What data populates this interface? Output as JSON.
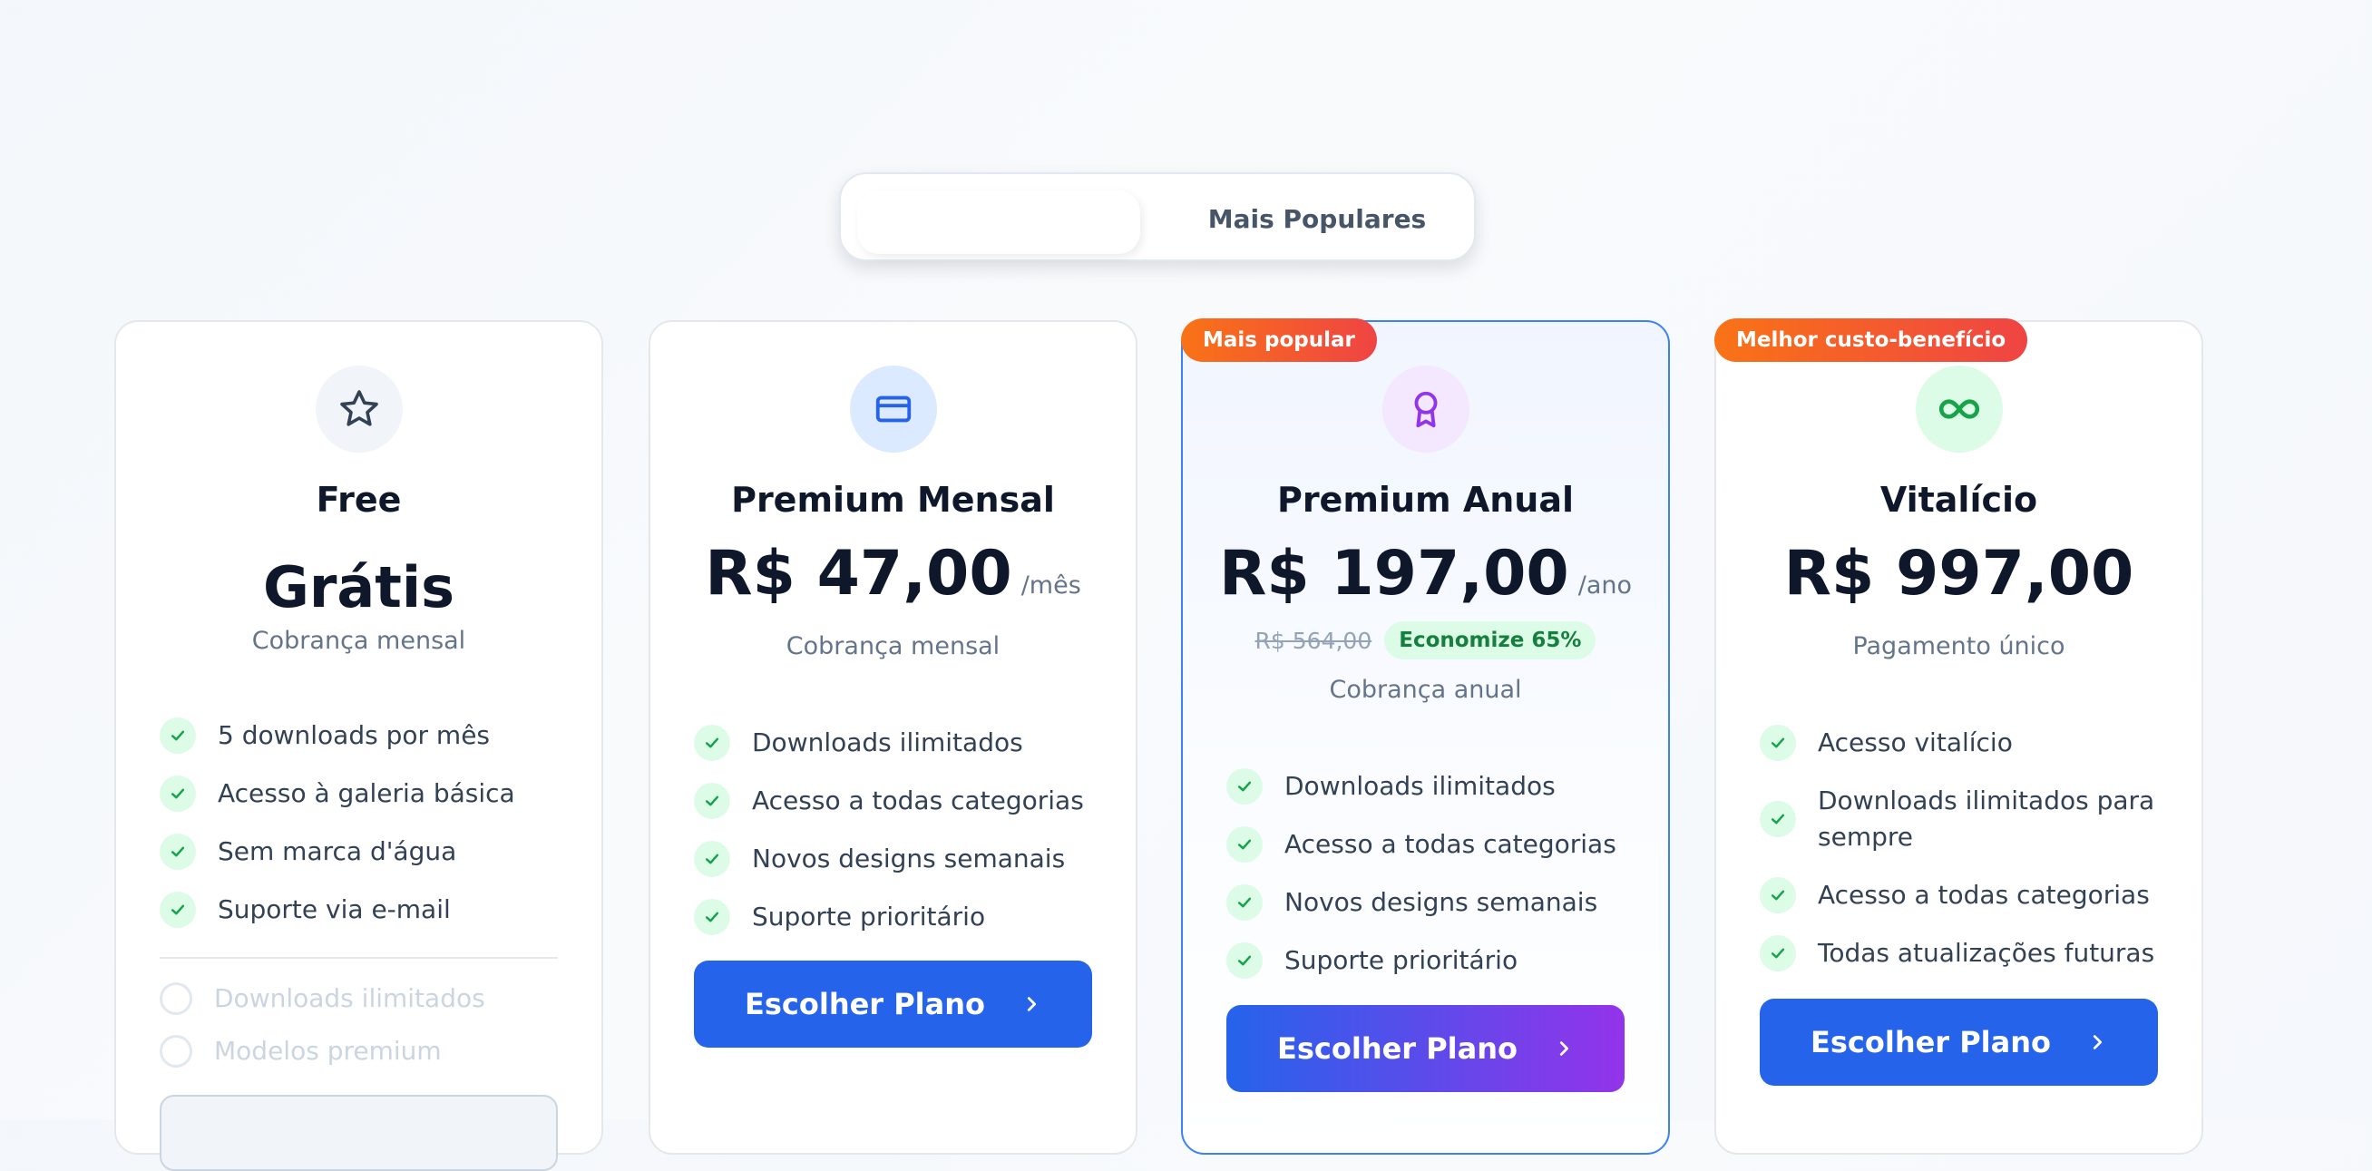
{
  "toggle": {
    "active_label": "",
    "other_label": "Mais Populares"
  },
  "plans": [
    {
      "title": "Free",
      "price": "Grátis",
      "billing": "Cobrança mensal",
      "icon": "star-icon",
      "features": [
        "5 downloads por mês",
        "Acesso à galeria básica",
        "Sem marca d'água",
        "Suporte via e-mail"
      ],
      "unavailable": [
        "Downloads ilimitados",
        "Modelos premium"
      ]
    },
    {
      "title": "Premium Mensal",
      "price": "R$ 47,00",
      "period": "/mês",
      "billing": "Cobrança mensal",
      "icon": "credit-card-icon",
      "features": [
        "Downloads ilimitados",
        "Acesso a todas categorias",
        "Novos designs semanais",
        "Suporte prioritário"
      ],
      "cta": "Escolher Plano"
    },
    {
      "badge": "Mais popular",
      "title": "Premium Anual",
      "price": "R$ 197,00",
      "period": "/ano",
      "old_price": "R$ 564,00",
      "savings": "Economize 65%",
      "billing": "Cobrança anual",
      "icon": "award-icon",
      "features": [
        "Downloads ilimitados",
        "Acesso a todas categorias",
        "Novos designs semanais",
        "Suporte prioritário"
      ],
      "cta": "Escolher Plano"
    },
    {
      "badge": "Melhor custo-benefício",
      "title": "Vitalício",
      "price": "R$ 997,00",
      "billing": "Pagamento único",
      "icon": "infinity-icon",
      "features": [
        "Acesso vitalício",
        "Downloads ilimitados para sempre",
        "Acesso a todas categorias",
        "Todas atualizações futuras"
      ],
      "cta": "Escolher Plano"
    }
  ],
  "colors": {
    "primary": "#2563eb",
    "accent_purple": "#9333ea",
    "badge_orange": "#f97316",
    "success": "#16a34a"
  }
}
